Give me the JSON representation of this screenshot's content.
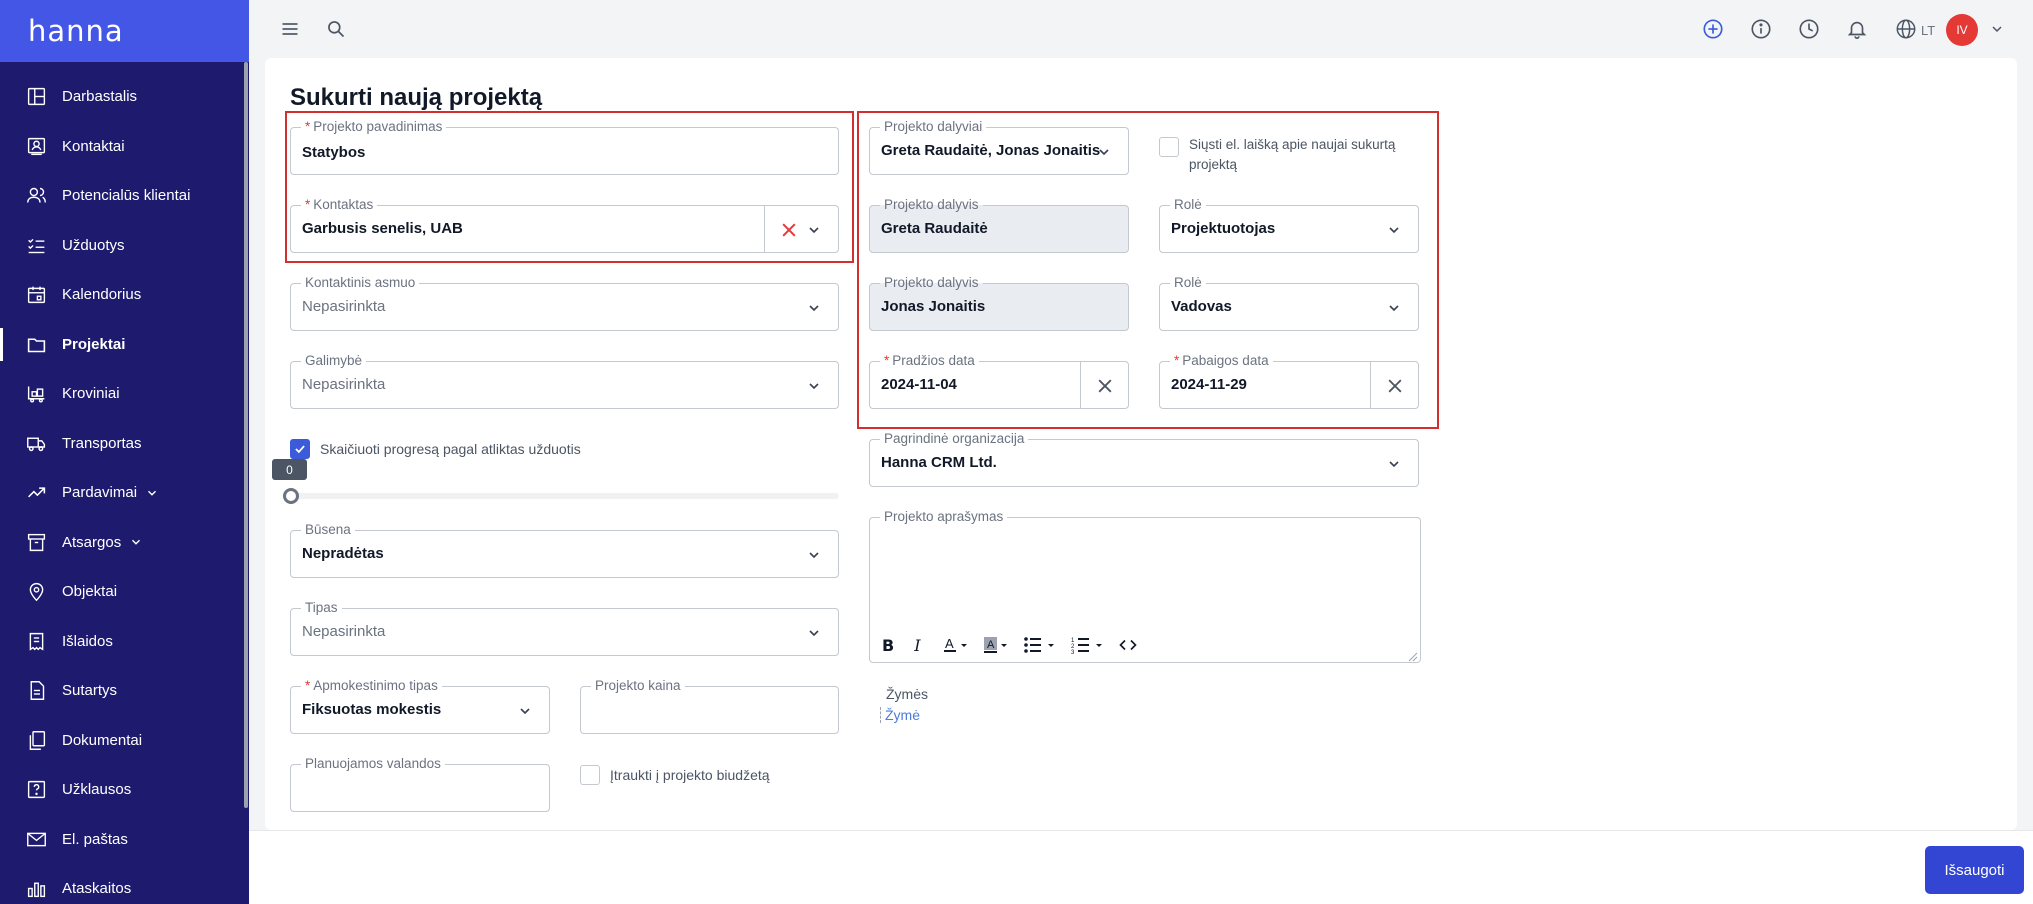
{
  "app": {
    "logo": "hanna"
  },
  "sidebar": {
    "items": [
      {
        "label": "Darbastalis",
        "icon": "dashboard-icon"
      },
      {
        "label": "Kontaktai",
        "icon": "contacts-icon"
      },
      {
        "label": "Potencialūs klientai",
        "icon": "leads-icon"
      },
      {
        "label": "Užduotys",
        "icon": "tasks-icon"
      },
      {
        "label": "Kalendorius",
        "icon": "calendar-icon"
      },
      {
        "label": "Projektai",
        "icon": "folder-icon",
        "active": true
      },
      {
        "label": "Kroviniai",
        "icon": "cargo-icon"
      },
      {
        "label": "Transportas",
        "icon": "truck-icon"
      },
      {
        "label": "Pardavimai",
        "icon": "trending-up-icon",
        "expandable": true
      },
      {
        "label": "Atsargos",
        "icon": "archive-icon",
        "expandable": true
      },
      {
        "label": "Objektai",
        "icon": "location-pin-icon"
      },
      {
        "label": "Išlaidos",
        "icon": "receipt-icon"
      },
      {
        "label": "Sutartys",
        "icon": "contract-icon"
      },
      {
        "label": "Dokumentai",
        "icon": "documents-icon"
      },
      {
        "label": "Užklausos",
        "icon": "question-icon"
      },
      {
        "label": "El. paštas",
        "icon": "mail-icon"
      },
      {
        "label": "Ataskaitos",
        "icon": "reports-icon"
      }
    ]
  },
  "topbar": {
    "language": "LT",
    "avatar_initials": "IV"
  },
  "page": {
    "title": "Sukurti naują projektą"
  },
  "form": {
    "name": {
      "label": "Projekto pavadinimas",
      "value": "Statybos"
    },
    "contact": {
      "label": "Kontaktas",
      "value": "Garbusis senelis, UAB"
    },
    "contact_person": {
      "label": "Kontaktinis asmuo",
      "placeholder": "Nepasirinkta"
    },
    "opportunity": {
      "label": "Galimybė",
      "placeholder": "Nepasirinkta"
    },
    "progress_checkbox": {
      "label": "Skaičiuoti progresą pagal atliktas užduotis",
      "checked": true
    },
    "progress": {
      "value": "0"
    },
    "status": {
      "label": "Būsena",
      "value": "Nepradėtas"
    },
    "type": {
      "label": "Tipas",
      "placeholder": "Nepasirinkta"
    },
    "billing_type": {
      "label": "Apmokestinimo tipas",
      "value": "Fiksuotas mokestis"
    },
    "price": {
      "label": "Projekto kaina",
      "value": ""
    },
    "planned_hours": {
      "label": "Planuojamos valandos",
      "value": ""
    },
    "include_budget": {
      "label": "Įtraukti į projekto biudžetą",
      "checked": false
    },
    "participants": {
      "label": "Projekto dalyviai",
      "value": "Greta Raudaitė, Jonas Jonaitis"
    },
    "send_email": {
      "label_line1": "Siųsti el. laišką apie naujai sukurtą",
      "label_line2": "projektą",
      "checked": false
    },
    "participant_rows": [
      {
        "participant_label": "Projekto dalyvis",
        "participant": "Greta Raudaitė",
        "role_label": "Rolė",
        "role": "Projektuotojas"
      },
      {
        "participant_label": "Projekto dalyvis",
        "participant": "Jonas Jonaitis",
        "role_label": "Rolė",
        "role": "Vadovas"
      }
    ],
    "start_date": {
      "label": "Pradžios data",
      "value": "2024-11-04"
    },
    "end_date": {
      "label": "Pabaigos data",
      "value": "2024-11-29"
    },
    "organization": {
      "label": "Pagrindinė organizacija",
      "value": "Hanna CRM Ltd."
    },
    "description": {
      "label": "Projekto aprašymas",
      "value": ""
    },
    "tags": {
      "label": "Žymės",
      "link": "Žymė"
    }
  },
  "actions": {
    "save_label": "Išsaugoti"
  },
  "colors": {
    "sidebar": "#1e1b6e",
    "brand": "#4456e6",
    "primary": "#3346d3",
    "highlight": "#d32f2f"
  }
}
